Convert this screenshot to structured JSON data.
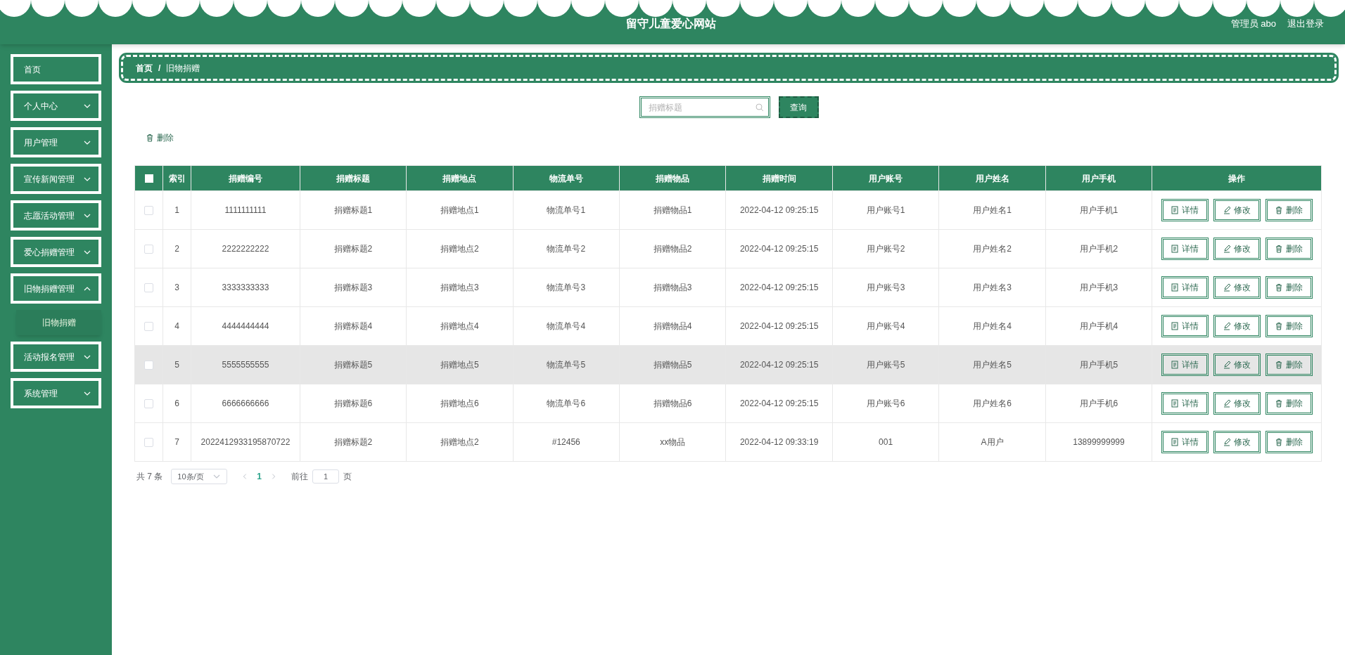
{
  "header": {
    "title": "留守儿童爱心网站",
    "user": "管理员 abo",
    "logout": "退出登录"
  },
  "sidebar": {
    "items": [
      {
        "label": "首页",
        "has_children": false
      },
      {
        "label": "个人中心",
        "has_children": true,
        "expanded": false
      },
      {
        "label": "用户管理",
        "has_children": true,
        "expanded": false
      },
      {
        "label": "宣传新闻管理",
        "has_children": true,
        "expanded": false
      },
      {
        "label": "志愿活动管理",
        "has_children": true,
        "expanded": false
      },
      {
        "label": "爱心捐赠管理",
        "has_children": true,
        "expanded": false
      },
      {
        "label": "旧物捐赠管理",
        "has_children": true,
        "expanded": true,
        "children": [
          {
            "label": "旧物捐赠",
            "selected": true
          }
        ]
      },
      {
        "label": "活动报名管理",
        "has_children": true,
        "expanded": false
      },
      {
        "label": "系统管理",
        "has_children": true,
        "expanded": false
      }
    ]
  },
  "breadcrumb": [
    "首页",
    "/",
    "旧物捐赠"
  ],
  "search": {
    "placeholder": "捐赠标题",
    "button": "查询"
  },
  "bulk_delete": "删除",
  "table": {
    "select_all": false,
    "columns": [
      "索引",
      "捐赠编号",
      "捐赠标题",
      "捐赠地点",
      "物流单号",
      "捐赠物品",
      "捐赠时间",
      "用户账号",
      "用户姓名",
      "用户手机",
      "操作"
    ],
    "rows": [
      {
        "checked": false,
        "highlighted": false,
        "cells": [
          "1",
          "1111111111",
          "捐赠标题1",
          "捐赠地点1",
          "物流单号1",
          "捐赠物品1",
          "2022-04-12 09:25:15",
          "用户账号1",
          "用户姓名1",
          "用户手机1"
        ],
        "actions": [
          "详情",
          "修改",
          "删除"
        ]
      },
      {
        "checked": false,
        "highlighted": false,
        "cells": [
          "2",
          "2222222222",
          "捐赠标题2",
          "捐赠地点2",
          "物流单号2",
          "捐赠物品2",
          "2022-04-12 09:25:15",
          "用户账号2",
          "用户姓名2",
          "用户手机2"
        ],
        "actions": [
          "详情",
          "修改",
          "删除"
        ]
      },
      {
        "checked": false,
        "highlighted": false,
        "cells": [
          "3",
          "3333333333",
          "捐赠标题3",
          "捐赠地点3",
          "物流单号3",
          "捐赠物品3",
          "2022-04-12 09:25:15",
          "用户账号3",
          "用户姓名3",
          "用户手机3"
        ],
        "actions": [
          "详情",
          "修改",
          "删除"
        ]
      },
      {
        "checked": false,
        "highlighted": false,
        "cells": [
          "4",
          "4444444444",
          "捐赠标题4",
          "捐赠地点4",
          "物流单号4",
          "捐赠物品4",
          "2022-04-12 09:25:15",
          "用户账号4",
          "用户姓名4",
          "用户手机4"
        ],
        "actions": [
          "详情",
          "修改",
          "删除"
        ]
      },
      {
        "checked": false,
        "highlighted": true,
        "cells": [
          "5",
          "5555555555",
          "捐赠标题5",
          "捐赠地点5",
          "物流单号5",
          "捐赠物品5",
          "2022-04-12 09:25:15",
          "用户账号5",
          "用户姓名5",
          "用户手机5"
        ],
        "actions": [
          "详情",
          "修改",
          "删除"
        ]
      },
      {
        "checked": false,
        "highlighted": false,
        "cells": [
          "6",
          "6666666666",
          "捐赠标题6",
          "捐赠地点6",
          "物流单号6",
          "捐赠物品6",
          "2022-04-12 09:25:15",
          "用户账号6",
          "用户姓名6",
          "用户手机6"
        ],
        "actions": [
          "详情",
          "修改",
          "删除"
        ]
      },
      {
        "checked": false,
        "highlighted": false,
        "cells": [
          "7",
          "2022412933195870722",
          "捐赠标题2",
          "捐赠地点2",
          "#12456",
          "xx物品",
          "2022-04-12 09:33:19",
          "001",
          "A用户",
          "13899999999"
        ],
        "actions": [
          "详情",
          "修改",
          "删除"
        ]
      }
    ]
  },
  "pagination": {
    "total": "共 7 条",
    "page_size": "10条/页",
    "pages": [
      {
        "label": "1",
        "selected": true
      }
    ],
    "goto_label": "前往",
    "goto_value": "1",
    "goto_suffix": "页"
  }
}
